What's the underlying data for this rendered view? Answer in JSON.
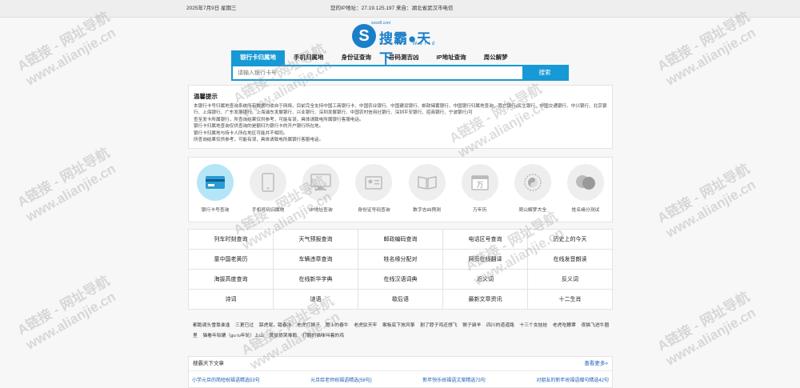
{
  "topbar": {
    "date": "2025年7月9日 星期三",
    "ip_text": "您的IP地址：27.19.125.197 来自：湖北省武汉市电信"
  },
  "logo": {
    "mark": "S",
    "name": "搜霸●天下",
    "sub": "Search World",
    "small": "soso8.com"
  },
  "search": {
    "tabs": [
      "银行卡归属地",
      "手机归属地",
      "身份证查询",
      "号码测吉凶",
      "IP地址查询",
      "周公解梦"
    ],
    "placeholder": "请输入银行卡号",
    "button": "搜索"
  },
  "notice": {
    "title": "温馨提示",
    "lines": [
      "本银行卡号归属地查询系统所有数据均收自于网络，目前完全支持中国工商银行卡、中国农业银行、中国建设银行、邮政储蓄银行、中国银行归属地查询，其它银行(民生银行、中国交通银行、中兴银行、北京银行、上海银行、广东发展银行、上海浦东发展银行、兴业银行、深圳发展银行、中国农村信用社银行、深圳平安银行、招商银行、宁波银行)可",
      "查至发卡所属银行，所查询结果仅供参考，可能有误，具体请致电所属银行客服电话。",
      "银行卡归属地查询仅供查询的是额归为银行卡的开户银行所在地。",
      "银行卡归属地与持卡人所在地区可能并不相同。",
      "所查询结果仅供参考，可能有误，具体请致电所属银行客服电话。"
    ]
  },
  "icons": [
    {
      "label": "银行卡号查询",
      "icon": "bank-card-icon"
    },
    {
      "label": "手机号码归属地",
      "icon": "mobile-phone-icon"
    },
    {
      "label": "IP地址查询",
      "icon": "monitor-icon"
    },
    {
      "label": "身份证号码查询",
      "icon": "id-card-icon"
    },
    {
      "label": "数字吉凶预测",
      "icon": "book-icon"
    },
    {
      "label": "万年历",
      "icon": "calendar-icon"
    },
    {
      "label": "周公解梦大全",
      "icon": "yin-yang-icon"
    },
    {
      "label": "姓名缘分测试",
      "icon": "heart-icon"
    }
  ],
  "grid": [
    "列车时刻查询",
    "天气预报查询",
    "邮政编码查询",
    "电话区号查询",
    "历史上的今天",
    "童中国老黄历",
    "车辆违章查询",
    "姓名缘分配对",
    "网页在线翻译",
    "在线发音朗读",
    "海拔高度查询",
    "在线新华字典",
    "在线汉语词典",
    "近义词",
    "反义词",
    "诗词",
    "谜语",
    "歇后语",
    "最新文章资讯",
    "十二生肖"
  ],
  "tags": [
    "都跑调头雪靠谁逢",
    "三更已过",
    "踩虎尾，踏春冰",
    "老虎打猴子",
    "蹬上的春牛",
    "老虎驮天牢",
    "案板底下放风筝",
    "割了脖子鸡还想飞",
    "猴子骑羊",
    "四川的道道路",
    "十三个女娃娃",
    "老虎吃鞭罩",
    "夜猫飞进牛圈里",
    "猫看年轱辘（gu lu年轮）上山",
    "黄鼠狼哭难鹅",
    "打酷的猫咪叫着的鸡"
  ],
  "articles": {
    "title": "搜霸天下文章",
    "more": "查看更多»",
    "items": [
      "小学元旦的简短祝福语精选53句",
      "元旦给老师祝福语精选(56句)",
      "新年快乐祝福语文案精选73句",
      "对朋友的新年祝福语赠句精选42句"
    ]
  },
  "watermark": {
    "line1": "A链接 - 网址导航",
    "line2": "www.alianjie.cn"
  }
}
